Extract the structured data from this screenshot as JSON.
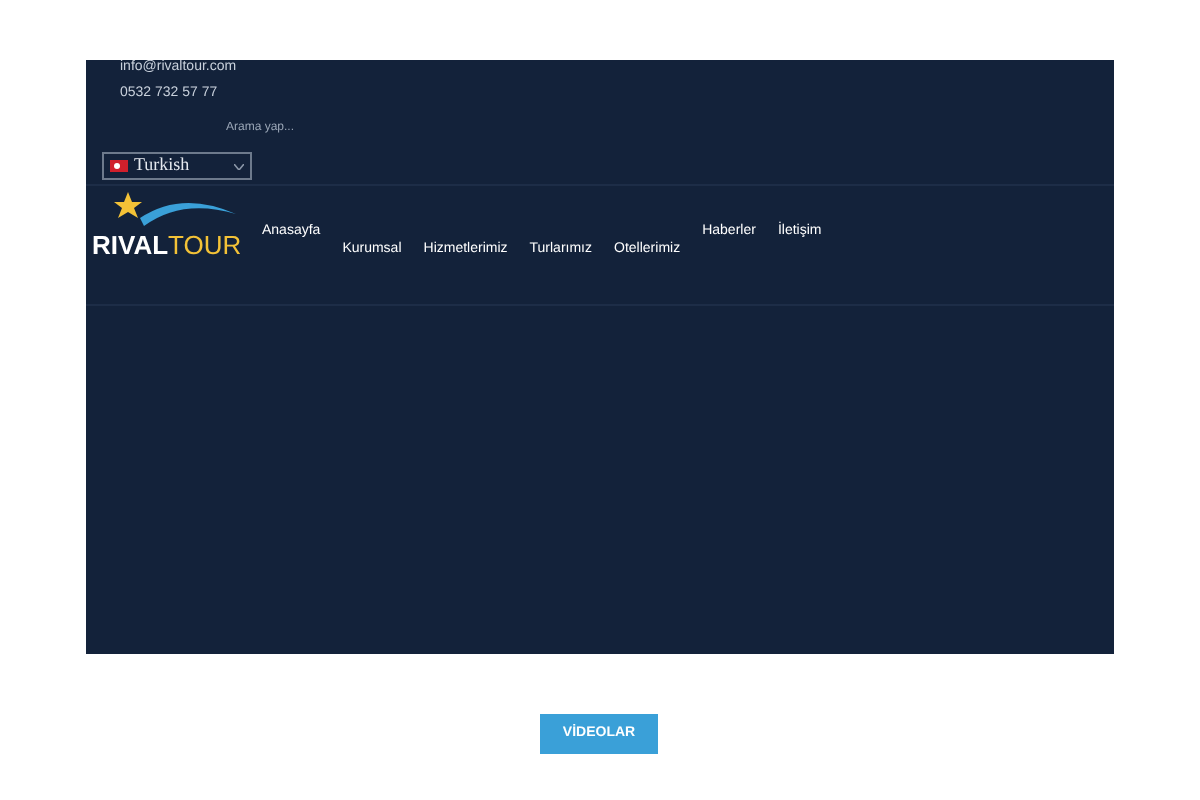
{
  "contact": {
    "email": "info@rivaltour.com",
    "phone": "0532 732 57 77"
  },
  "search": {
    "placeholder": "Arama yap..."
  },
  "language": {
    "label": "Turkish"
  },
  "logo": {
    "word_1": "RIVAL",
    "word_2": "TOUR"
  },
  "nav": [
    {
      "label": "Anasayfa"
    },
    {
      "label": "Kurumsal"
    },
    {
      "label": "Hizmetlerimiz"
    },
    {
      "label": "Turlarımız"
    },
    {
      "label": "Otellerimiz"
    },
    {
      "label": "Haberler"
    },
    {
      "label": "İletişim"
    }
  ],
  "button": {
    "label": "VİDEOLAR"
  }
}
